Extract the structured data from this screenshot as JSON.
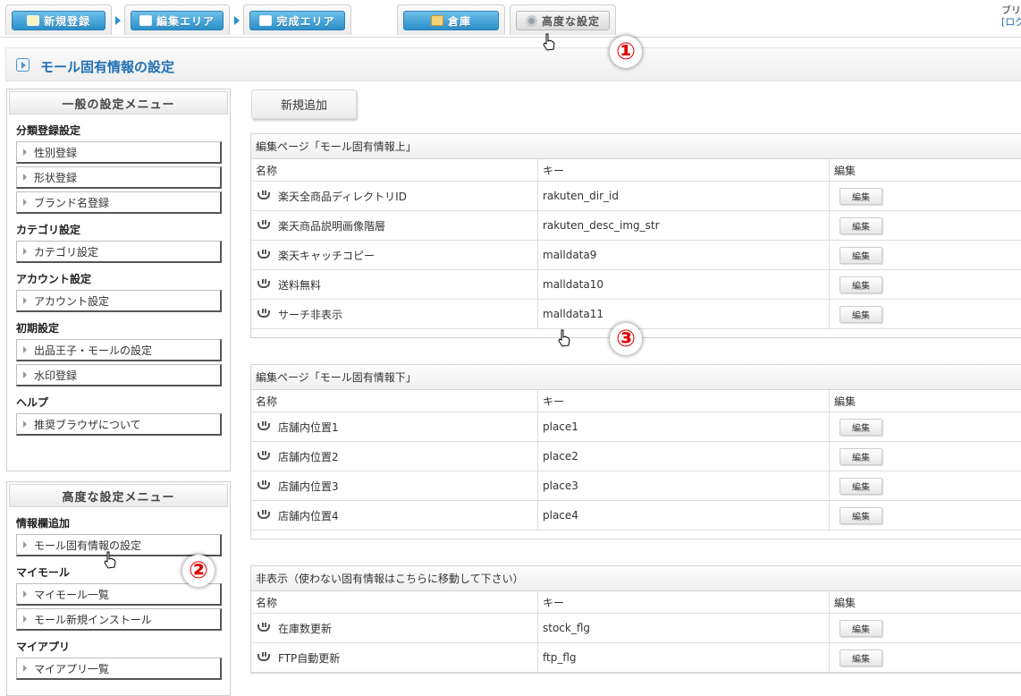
{
  "tabs": [
    {
      "label": "新規登録",
      "icon": "pencil-icon"
    },
    {
      "label": "編集エリア",
      "icon": "list-icon"
    },
    {
      "label": "完成エリア",
      "icon": "chart-icon"
    },
    {
      "label": "倉庫",
      "icon": "box-icon"
    },
    {
      "label": "高度な設定",
      "icon": "gear-icon"
    }
  ],
  "top_right": {
    "line1": "ブリリ",
    "line2": "[ログ"
  },
  "page_title": "モール固有情報の設定",
  "sidebar": {
    "general_menu": {
      "title": "一般の設定メニュー",
      "sections": [
        {
          "title": "分類登録設定",
          "items": [
            "性別登録",
            "形状登録",
            "ブランド名登録"
          ]
        },
        {
          "title": "カテゴリ設定",
          "items": [
            "カテゴリ設定"
          ]
        },
        {
          "title": "アカウント設定",
          "items": [
            "アカウント設定"
          ]
        },
        {
          "title": "初期設定",
          "items": [
            "出品王子・モールの設定",
            "水印登録"
          ]
        },
        {
          "title": "ヘルプ",
          "items": [
            "推奨ブラウザについて"
          ]
        }
      ]
    },
    "advanced_menu": {
      "title": "高度な設定メニュー",
      "sections": [
        {
          "title": "情報欄追加",
          "items": [
            "モール固有情報の設定"
          ]
        },
        {
          "title": "マイモール",
          "items": [
            "マイモール一覧",
            "モール新規インストール"
          ]
        },
        {
          "title": "マイアプリ",
          "items": [
            "マイアプリ一覧"
          ]
        }
      ]
    }
  },
  "main": {
    "add_button": "新規追加",
    "columns": {
      "name": "名称",
      "key": "キー",
      "edit": "編集"
    },
    "edit_label": "編集",
    "panels": [
      {
        "title": "編集ページ「モール固有情報上」",
        "rows": [
          {
            "name": "楽天全商品ディレクトリID",
            "key": "rakuten_dir_id"
          },
          {
            "name": "楽天商品説明画像階層",
            "key": "rakuten_desc_img_str"
          },
          {
            "name": "楽天キャッチコピー",
            "key": "malldata9"
          },
          {
            "name": "送料無料",
            "key": "malldata10"
          },
          {
            "name": "サーチ非表示",
            "key": "malldata11"
          }
        ]
      },
      {
        "title": "編集ページ「モール固有情報下」",
        "rows": [
          {
            "name": "店舗内位置1",
            "key": "place1"
          },
          {
            "name": "店舗内位置2",
            "key": "place2"
          },
          {
            "name": "店舗内位置3",
            "key": "place3"
          },
          {
            "name": "店舗内位置4",
            "key": "place4"
          }
        ]
      },
      {
        "title": "非表示（使わない固有情報はこちらに移動して下さい）",
        "rows": [
          {
            "name": "在庫数更新",
            "key": "stock_flg"
          },
          {
            "name": "FTP自動更新",
            "key": "ftp_flg"
          }
        ]
      }
    ]
  },
  "annotations": [
    "①",
    "②",
    "③"
  ]
}
